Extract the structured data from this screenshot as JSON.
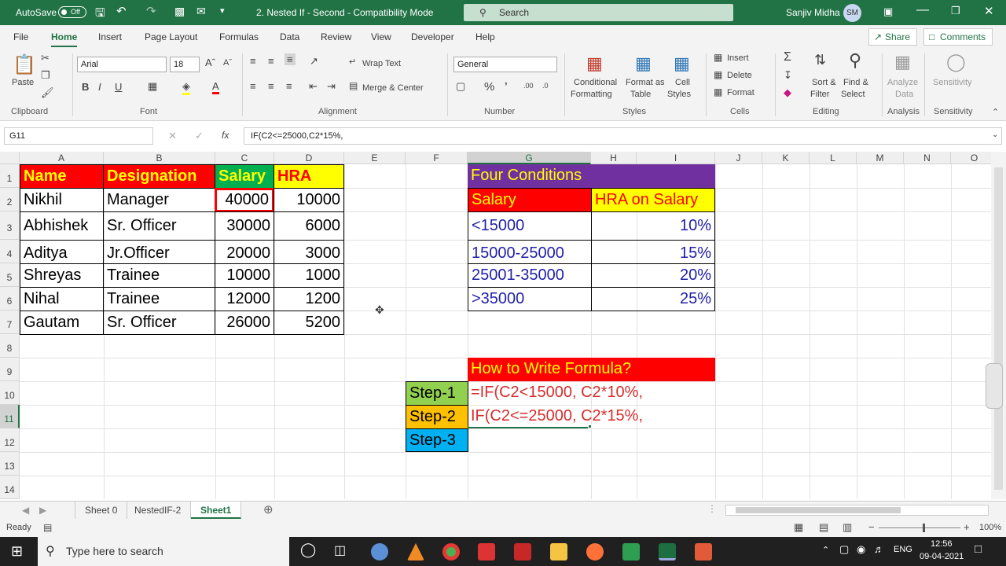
{
  "titlebar": {
    "autosave_label": "AutoSave",
    "autosave_state": "Off",
    "doc_title": "2. Nested If - Second  -  Compatibility Mode",
    "search_placeholder": "Search",
    "user_name": "Sanjiv Midha",
    "user_initials": "SM"
  },
  "menu": {
    "items": [
      "File",
      "Home",
      "Insert",
      "Page Layout",
      "Formulas",
      "Data",
      "Review",
      "View",
      "Developer",
      "Help"
    ],
    "share": "Share",
    "comments": "Comments"
  },
  "ribbon": {
    "clipboard": {
      "paste": "Paste",
      "label": "Clipboard"
    },
    "font": {
      "name": "Arial",
      "size": "18",
      "label": "Font"
    },
    "alignment": {
      "wrap": "Wrap Text",
      "merge": "Merge & Center",
      "label": "Alignment"
    },
    "number": {
      "format": "General",
      "label": "Number"
    },
    "styles": {
      "cond1": "Conditional",
      "cond2": "Formatting",
      "fmt1": "Format as",
      "fmt2": "Table",
      "cell1": "Cell",
      "cell2": "Styles",
      "label": "Styles"
    },
    "cells": {
      "insert": "Insert",
      "delete": "Delete",
      "format": "Format",
      "label": "Cells"
    },
    "editing": {
      "sort1": "Sort &",
      "sort2": "Filter",
      "find1": "Find &",
      "find2": "Select",
      "label": "Editing"
    },
    "analysis": {
      "a1": "Analyze",
      "a2": "Data",
      "label": "Analysis"
    },
    "sensitivity": {
      "s1": "Sensitivity",
      "label": "Sensitivity"
    }
  },
  "formula_bar": {
    "name_box": "G11",
    "fx": "fx",
    "formula": "IF(C2<=25000,C2*15%,"
  },
  "columns": [
    "A",
    "B",
    "C",
    "D",
    "E",
    "F",
    "G",
    "H",
    "I",
    "J",
    "K",
    "L",
    "M",
    "N",
    "O"
  ],
  "rows": [
    "1",
    "2",
    "3",
    "4",
    "5",
    "6",
    "7",
    "8",
    "9",
    "10",
    "11",
    "12",
    "13",
    "14"
  ],
  "table": {
    "headers": [
      "Name",
      "Designation",
      "Salary",
      "HRA"
    ],
    "rows": [
      [
        "Nikhil",
        "Manager",
        "40000",
        "10000"
      ],
      [
        "Abhishek",
        "Sr. Officer",
        "30000",
        "6000"
      ],
      [
        "Aditya",
        "Jr.Officer",
        "20000",
        "3000"
      ],
      [
        "Shreyas",
        "Trainee",
        "10000",
        "1000"
      ],
      [
        "Nihal",
        "Trainee",
        "12000",
        "1200"
      ],
      [
        "Gautam",
        "Sr. Officer",
        "26000",
        "5200"
      ]
    ]
  },
  "conditions": {
    "title": "Four Conditions",
    "col1": "Salary",
    "col2": "HRA on Salary",
    "rows": [
      [
        "<15000",
        "10%"
      ],
      [
        "15000-25000",
        "15%"
      ],
      [
        "25001-35000",
        "20%"
      ],
      [
        ">35000",
        "25%"
      ]
    ]
  },
  "formula_help": {
    "title": "How to Write Formula?",
    "step1": "Step-1",
    "step2": "Step-2",
    "step3": "Step-3",
    "f1": "=IF(C2<15000, C2*10%,",
    "f2": "IF(C2<=25000, C2*15%,"
  },
  "sheets": [
    "Sheet 0",
    "NestedIF-2",
    "Sheet1"
  ],
  "status": {
    "ready": "Ready",
    "zoom": "100%"
  },
  "taskbar": {
    "search": "Type here to search",
    "lang": "ENG",
    "time": "12:56",
    "date": "09-04-2021"
  },
  "colors": {
    "excel_green": "#217346",
    "red": "#ff0000",
    "yellow": "#ffff00",
    "green": "#00b050",
    "purple": "#7030a0",
    "orange": "#ffc000",
    "blue": "#00b0f0",
    "lightgreen": "#92d050",
    "navy": "#1f1fa8"
  }
}
